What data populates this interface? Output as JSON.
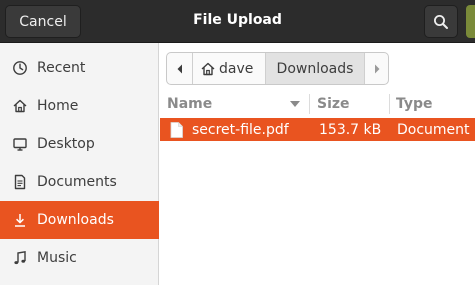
{
  "header": {
    "cancel_label": "Cancel",
    "title": "File Upload"
  },
  "sidebar": {
    "items": [
      {
        "label": "Recent",
        "icon": "recent-icon"
      },
      {
        "label": "Home",
        "icon": "home-icon"
      },
      {
        "label": "Desktop",
        "icon": "desktop-icon"
      },
      {
        "label": "Documents",
        "icon": "documents-icon"
      },
      {
        "label": "Downloads",
        "icon": "downloads-icon",
        "active": true
      },
      {
        "label": "Music",
        "icon": "music-icon"
      }
    ]
  },
  "pathbar": {
    "home_label": "dave",
    "current_label": "Downloads"
  },
  "columns": {
    "name": "Name",
    "size": "Size",
    "type": "Type"
  },
  "files": [
    {
      "name": "secret-file.pdf",
      "size": "153.7 kB",
      "type": "Document"
    }
  ],
  "colors": {
    "accent": "#e95420",
    "headerbar": "#2c2c2c"
  }
}
